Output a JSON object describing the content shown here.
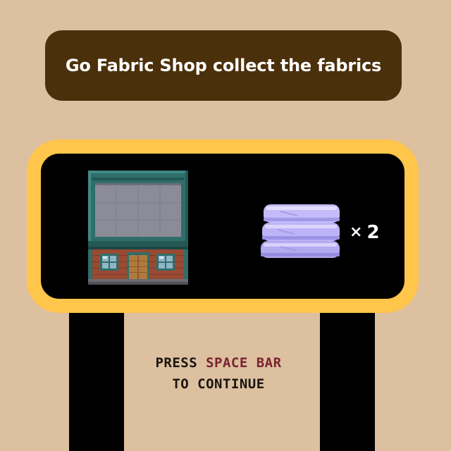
{
  "banner": {
    "text": "Go Fabric Shop collect the fabrics"
  },
  "reward": {
    "building_icon": "fabric-shop-building-icon",
    "item_icon": "fabric-bolts-icon",
    "multiplier": "×",
    "quantity": "2"
  },
  "prompt": {
    "press": "PRESS",
    "key": "SPACE BAR",
    "continue": "TO CONTINUE"
  },
  "colors": {
    "background": "#dcc09f",
    "banner": "#4b300c",
    "panel_border": "#ffc64b",
    "panel": "#000000",
    "key_highlight": "#7a2230",
    "fabric": "#bcb4f6"
  }
}
